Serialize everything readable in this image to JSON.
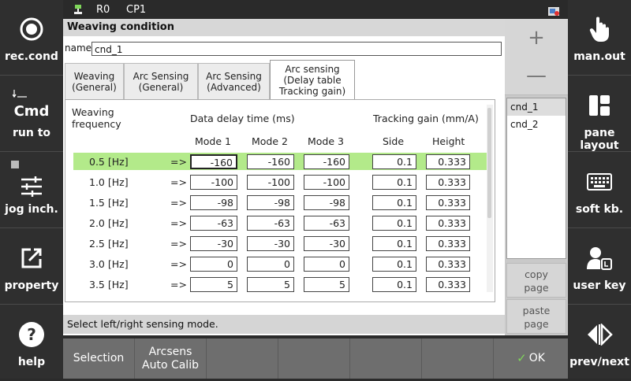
{
  "status_bar": {
    "robot": "R0",
    "cp": "CP1"
  },
  "left_buttons": [
    {
      "label": "rec.cond",
      "icon": "record-circle-icon"
    },
    {
      "label": "run to",
      "big": "Cmd",
      "icon": "run-to-icon"
    },
    {
      "label": "jog inch.",
      "icon": "sliders-icon"
    },
    {
      "label": "property",
      "icon": "external-link-icon"
    },
    {
      "label": "help",
      "icon": "help-icon"
    }
  ],
  "right_buttons": [
    {
      "label": "man.out",
      "icon": "hand-pointer-icon"
    },
    {
      "label": "pane layout",
      "icon": "layout-icon"
    },
    {
      "label": "soft kb.",
      "icon": "keyboard-icon"
    },
    {
      "label": "user key",
      "icon": "user-key-icon"
    },
    {
      "label": "prev/next",
      "icon": "prev-next-icon"
    }
  ],
  "window": {
    "title": "Weaving condition",
    "name_label": "name",
    "name_value": "cnd_1"
  },
  "tabs": [
    {
      "line1": "Weaving",
      "line2": "(General)",
      "line3": ""
    },
    {
      "line1": "Arc Sensing",
      "line2": "(General)",
      "line3": ""
    },
    {
      "line1": "Arc Sensing",
      "line2": "(Advanced)",
      "line3": ""
    },
    {
      "line1": "Arc sensing",
      "line2": "(Delay table",
      "line3": "Tracking gain)"
    }
  ],
  "table": {
    "header_freq_1": "Weaving",
    "header_freq_2": "frequency",
    "header_delay": "Data delay time (ms)",
    "header_gain": "Tracking gain (mm/A)",
    "col_mode1": "Mode 1",
    "col_mode2": "Mode 2",
    "col_mode3": "Mode 3",
    "col_side": "Side",
    "col_height": "Height",
    "arrow": "=>",
    "rows": [
      {
        "freq": "0.5 [Hz]",
        "m1": "-160",
        "m2": "-160",
        "m3": "-160",
        "side": "0.1",
        "height": "0.333"
      },
      {
        "freq": "1.0 [Hz]",
        "m1": "-100",
        "m2": "-100",
        "m3": "-100",
        "side": "0.1",
        "height": "0.333"
      },
      {
        "freq": "1.5 [Hz]",
        "m1": "-98",
        "m2": "-98",
        "m3": "-98",
        "side": "0.1",
        "height": "0.333"
      },
      {
        "freq": "2.0 [Hz]",
        "m1": "-63",
        "m2": "-63",
        "m3": "-63",
        "side": "0.1",
        "height": "0.333"
      },
      {
        "freq": "2.5 [Hz]",
        "m1": "-30",
        "m2": "-30",
        "m3": "-30",
        "side": "0.1",
        "height": "0.333"
      },
      {
        "freq": "3.0 [Hz]",
        "m1": "0",
        "m2": "0",
        "m3": "0",
        "side": "0.1",
        "height": "0.333"
      },
      {
        "freq": "3.5 [Hz]",
        "m1": "5",
        "m2": "5",
        "m3": "5",
        "side": "0.1",
        "height": "0.333"
      }
    ]
  },
  "status_message": "Select left/right sensing mode.",
  "right_panel": {
    "plus": "+",
    "minus": "—",
    "conditions": [
      "cnd_1",
      "cnd_2"
    ],
    "copy_line1": "copy",
    "copy_line2": "page",
    "paste_line1": "paste",
    "paste_line2": "page"
  },
  "bottom_bar": {
    "selection": "Selection",
    "arcsens_1": "Arcsens",
    "arcsens_2": "Auto Calib",
    "ok": "OK"
  },
  "colors": {
    "highlight_row": "#b3ea8a",
    "side_bg": "#2f2f2f",
    "bottom_bg": "#6e6e6e"
  }
}
